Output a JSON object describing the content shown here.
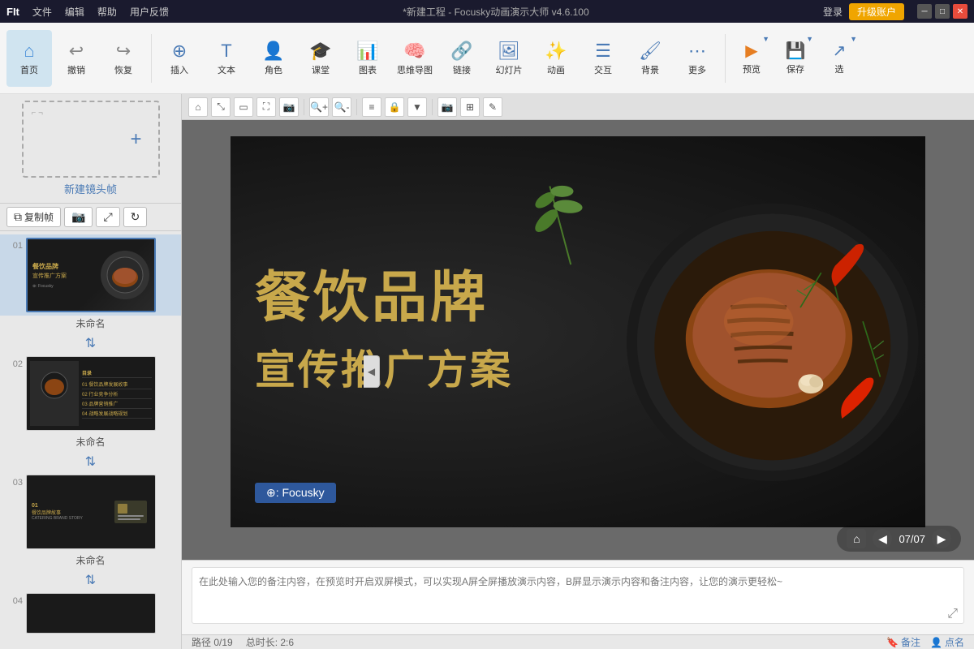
{
  "titlebar": {
    "app_name": "FIt",
    "menu": [
      "文件",
      "编辑",
      "帮助",
      "用户反馈"
    ],
    "title": "*新建工程 - Focusky动画演示大师  v4.6.100",
    "login": "登录",
    "upgrade": "升级账户"
  },
  "toolbar": {
    "home": "首页",
    "undo": "撤销",
    "redo": "恢复",
    "insert": "插入",
    "text": "文本",
    "character": "角色",
    "lesson": "课堂",
    "chart": "图表",
    "mindmap": "思维导图",
    "link": "链接",
    "slides": "幻灯片",
    "animation": "动画",
    "interact": "交互",
    "background": "背景",
    "more": "更多",
    "preview": "预览",
    "save": "保存",
    "select": "选"
  },
  "slide_panel": {
    "new_frame": "新建镜头帧",
    "copy_frame": "复制帧",
    "slides": [
      {
        "number": "01",
        "name": "未命名",
        "active": true
      },
      {
        "number": "02",
        "name": "未命名",
        "active": false
      },
      {
        "number": "03",
        "name": "未命名",
        "active": false
      },
      {
        "number": "04",
        "name": "",
        "active": false
      }
    ]
  },
  "canvas": {
    "slide_title_1": "餐饮品牌",
    "slide_title_2": "宣传推广方案",
    "big_text_1": "餐饮品牌",
    "big_text_2": "宣传推广方案",
    "focusky_label": "⊕: Focusky",
    "page_indicator": "07/07"
  },
  "status_bar": {
    "path": "路径 0/19",
    "duration": "总时长: 2:6",
    "note_btn": "备注",
    "pin_btn": "点名"
  },
  "notes": {
    "placeholder": "在此处输入您的备注内容，在预览时开启双屏模式，可以实现A屏全屏播放演示内容，B屏显示演示内容和备注内容，让您的演示更轻松~"
  }
}
